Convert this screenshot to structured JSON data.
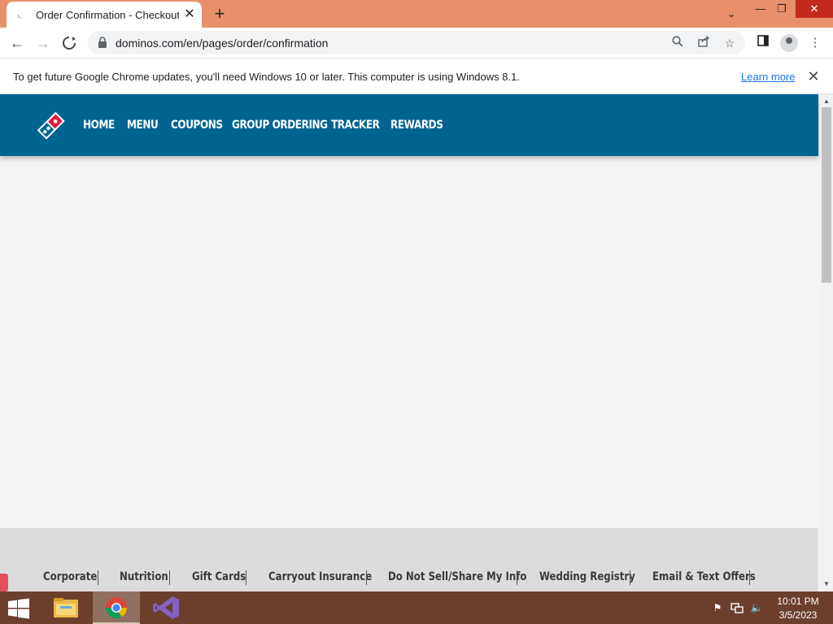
{
  "browser": {
    "tab": {
      "title": "Order Confirmation - Checkout (",
      "close": "✕"
    },
    "new_tab": "+",
    "window_controls": {
      "tab_search": "⌄",
      "minimize": "—",
      "restore": "❐",
      "close": "✕"
    },
    "url": "dominos.com/en/pages/order/confirmation",
    "icons": [
      "back-icon",
      "forward-icon",
      "stop-loading-icon",
      "lock-icon",
      "search-icon",
      "share-icon",
      "bookmark-star-icon",
      "side-panel-icon",
      "profile-icon",
      "menu-icon"
    ]
  },
  "infobar": {
    "message": "To get future Google Chrome updates, you'll need Windows 10 or later. This computer is using Windows 8.1.",
    "link": "Learn more",
    "close": "✕"
  },
  "site": {
    "brand_colors": {
      "header": "#006491",
      "logo_red": "#e31837",
      "logo_blue": "#006491"
    },
    "nav": [
      "HOME",
      "MENU",
      "COUPONS",
      "GROUP ORDERING",
      "TRACKER",
      "REWARDS"
    ],
    "footer_links": [
      "Corporate",
      "Nutrition",
      "Gift Cards",
      "Carryout Insurance",
      "Do Not Sell/Share My Info",
      "Wedding Registry",
      "Email & Text Offers"
    ]
  },
  "taskbar": {
    "apps": [
      "file-explorer-icon",
      "chrome-icon",
      "visual-studio-icon"
    ],
    "time": "10:01 PM",
    "date": "3/5/2023"
  }
}
